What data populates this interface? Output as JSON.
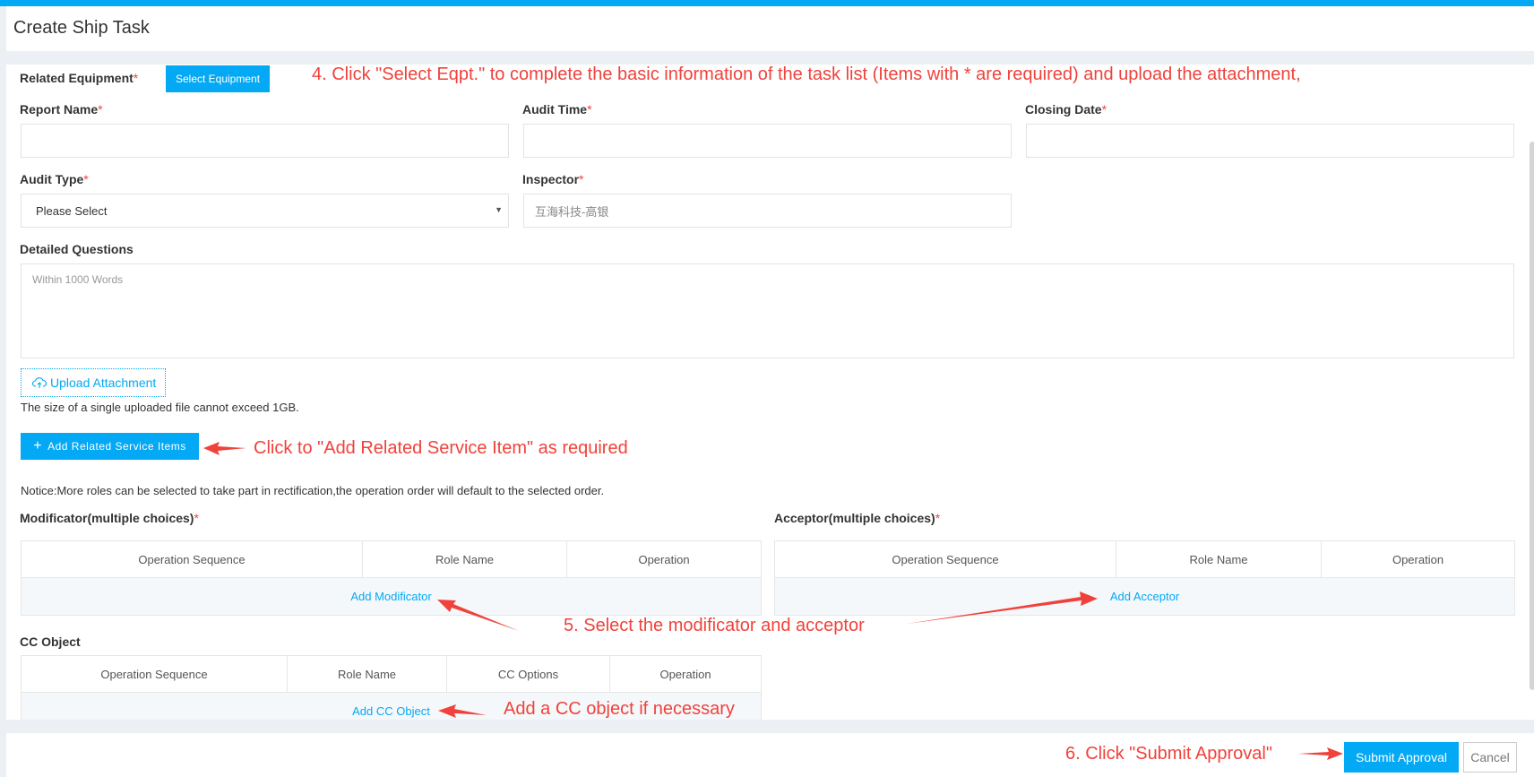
{
  "header": {
    "title": "Create Ship Task"
  },
  "form": {
    "related_equipment": {
      "label": "Related Equipment",
      "required_mark": "*",
      "button": "Select Equipment"
    },
    "report_name": {
      "label": "Report Name",
      "required_mark": "*",
      "value": ""
    },
    "audit_time": {
      "label": "Audit Time",
      "required_mark": "*",
      "value": ""
    },
    "closing_date": {
      "label": "Closing Date",
      "required_mark": "*",
      "value": ""
    },
    "audit_type": {
      "label": "Audit Type",
      "required_mark": "*",
      "selected": "Please Select",
      "arrow": "▼"
    },
    "inspector": {
      "label": "Inspector",
      "required_mark": "*",
      "value": "互海科技-高银"
    },
    "detailed_questions": {
      "label": "Detailed Questions",
      "placeholder": "Within 1000 Words"
    },
    "upload": {
      "button": "Upload Attachment",
      "icon": "cloud-upload-icon",
      "note": "The size of a single uploaded file cannot exceed 1GB."
    },
    "add_service_items": {
      "button": "Add Related Service Items",
      "icon": "plus-icon"
    },
    "notice": "Notice:More roles can be selected to take part in rectification,the operation order will default to the selected order."
  },
  "modificator": {
    "label": "Modificator(multiple choices)",
    "required_mark": "*",
    "columns": [
      "Operation Sequence",
      "Role Name",
      "Operation"
    ],
    "add_link": "Add Modificator"
  },
  "acceptor": {
    "label": "Acceptor(multiple choices)",
    "required_mark": "*",
    "columns": [
      "Operation Sequence",
      "Role Name",
      "Operation"
    ],
    "add_link": "Add Acceptor"
  },
  "cc_object": {
    "label": "CC Object",
    "columns": [
      "Operation Sequence",
      "Role Name",
      "CC Options",
      "Operation"
    ],
    "add_link": "Add CC Object"
  },
  "footer": {
    "submit": "Submit Approval",
    "cancel": "Cancel"
  },
  "annotations": {
    "step4": "4. Click \"Select Eqpt.\" to complete the basic information of the task list (Items with * are required) and upload the attachment,",
    "service_item": "Click to \"Add Related Service Item\" as required",
    "step5": "5. Select the modificator and acceptor",
    "cc": "Add a CC object if necessary",
    "step6": "6. Click \"Submit Approval\""
  },
  "colors": {
    "accent": "#03a9f4",
    "annotation": "#f0423b",
    "required": "#f0423b",
    "page_bg": "#eceff3",
    "table_body": "#f5f8fb"
  }
}
